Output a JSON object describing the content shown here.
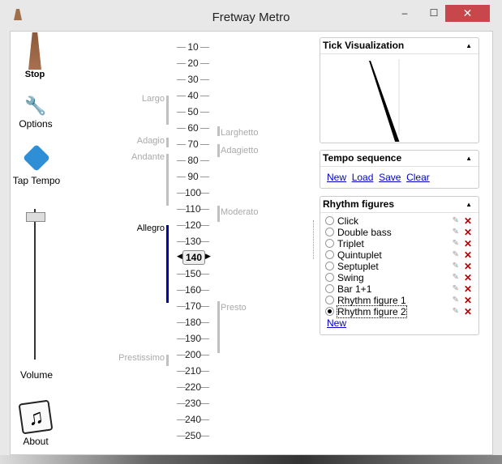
{
  "window": {
    "title": "Fretway Metro",
    "minimize": "–",
    "maximize": "☐",
    "close": "✕"
  },
  "left": {
    "stop": "Stop",
    "options": "Options",
    "tap": "Tap Tempo",
    "volume": "Volume",
    "volume_level": 0.95,
    "about": "About"
  },
  "scale": {
    "values": [
      10,
      20,
      30,
      40,
      50,
      60,
      70,
      80,
      90,
      100,
      110,
      120,
      130,
      140,
      150,
      160,
      170,
      180,
      190,
      200,
      210,
      220,
      230,
      240,
      250
    ],
    "current": "140",
    "left_terms": [
      {
        "name": "Largo",
        "from": 40,
        "to": 58,
        "active": false
      },
      {
        "name": "Adagio",
        "from": 66,
        "to": 72,
        "active": false
      },
      {
        "name": "Andante",
        "from": 76,
        "to": 108,
        "active": false
      },
      {
        "name": "Allegro",
        "from": 120,
        "to": 168,
        "active": true
      },
      {
        "name": "Prestissimo",
        "from": 200,
        "to": 207,
        "active": false
      }
    ],
    "right_terms": [
      {
        "name": "Larghetto",
        "from": 60,
        "to": 66
      },
      {
        "name": "Adagietto",
        "from": 71,
        "to": 79
      },
      {
        "name": "Moderato",
        "from": 109,
        "to": 119
      },
      {
        "name": "Presto",
        "from": 168,
        "to": 200
      }
    ]
  },
  "tick": {
    "title": "Tick Visualization"
  },
  "tempo_seq": {
    "title": "Tempo sequence",
    "links": [
      "New",
      "Load",
      "Save",
      "Clear"
    ]
  },
  "rhythm": {
    "title": "Rhythm figures",
    "items": [
      "Click",
      "Double bass",
      "Triplet",
      "Quintuplet",
      "Septuplet",
      "Swing",
      "Bar 1+1",
      "Rhythm figure 1",
      "Rhythm figure 2"
    ],
    "selected": 8,
    "new": "New"
  },
  "colors": {
    "accent": "#0000aa",
    "close": "#c7474b"
  }
}
